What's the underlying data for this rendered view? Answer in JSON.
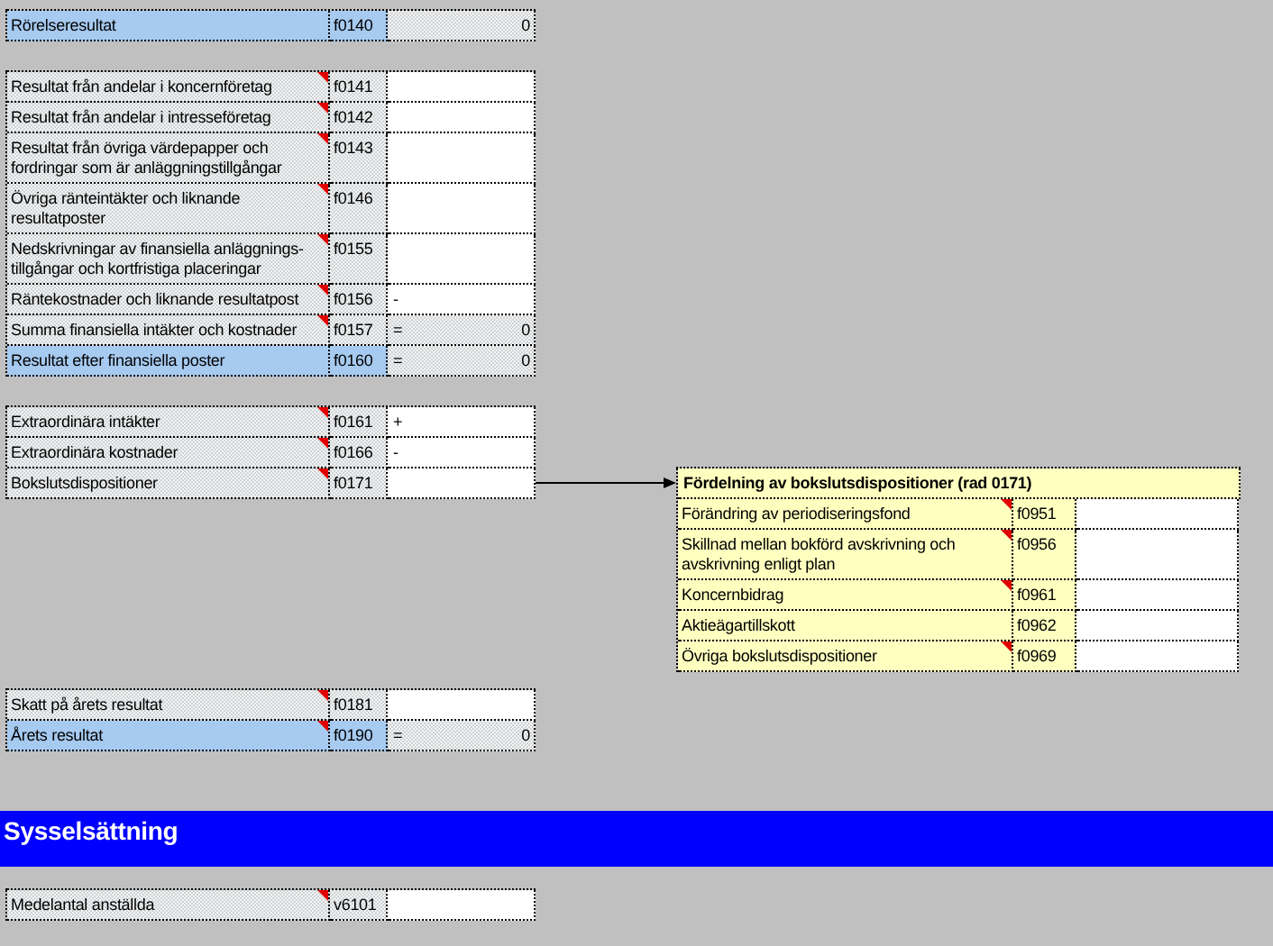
{
  "sections": [
    {
      "rows": [
        {
          "label": "Rörelseresultat",
          "code": "f0140",
          "note": false,
          "total": true,
          "kind": "computed",
          "sign": "",
          "value": "0"
        }
      ]
    },
    {
      "rows": [
        {
          "label": "Resultat från andelar i koncernföretag",
          "code": "f0141",
          "note": true,
          "total": false,
          "kind": "input",
          "sign": "",
          "value": ""
        },
        {
          "label": "Resultat från andelar i intresseföretag",
          "code": "f0142",
          "note": true,
          "total": false,
          "kind": "input",
          "sign": "",
          "value": ""
        },
        {
          "label": "Resultat från övriga värdepapper och fordringar som är anläggningstillgångar",
          "code": "f0143",
          "note": true,
          "total": false,
          "kind": "input",
          "sign": "",
          "value": ""
        },
        {
          "label": "Övriga ränteintäkter och liknande resultatposter",
          "code": "f0146",
          "note": true,
          "total": false,
          "kind": "input",
          "sign": "",
          "value": ""
        },
        {
          "label": "Nedskrivningar av finansiella anläggnings-tillgångar och kortfristiga placeringar",
          "code": "f0155",
          "note": true,
          "total": false,
          "kind": "input",
          "sign": "",
          "value": ""
        },
        {
          "label": "Räntekostnader och liknande resultatpost",
          "code": "f0156",
          "note": true,
          "total": false,
          "kind": "input",
          "sign": "-",
          "value": ""
        },
        {
          "label": "Summa finansiella intäkter och kostnader",
          "code": "f0157",
          "note": true,
          "total": false,
          "kind": "computed",
          "sign": "=",
          "value": "0"
        },
        {
          "label": "Resultat efter finansiella poster",
          "code": "f0160",
          "note": false,
          "total": true,
          "kind": "computed",
          "sign": "=",
          "value": "0"
        }
      ]
    },
    {
      "rows": [
        {
          "label": "Extraordinära intäkter",
          "code": "f0161",
          "note": true,
          "total": false,
          "kind": "input",
          "sign": "+",
          "value": ""
        },
        {
          "label": "Extraordinära kostnader",
          "code": "f0166",
          "note": true,
          "total": false,
          "kind": "input",
          "sign": "-",
          "value": ""
        },
        {
          "label": "Bokslutsdispositioner",
          "code": "f0171",
          "note": true,
          "total": false,
          "kind": "input",
          "sign": "",
          "value": ""
        }
      ],
      "breakdown": {
        "title": "Fördelning av bokslutsdispositioner (rad 0171)",
        "rows": [
          {
            "label": "Förändring av periodiseringsfond",
            "code": "f0951",
            "note": true
          },
          {
            "label": "Skillnad mellan bokförd avskrivning och avskrivning enligt plan",
            "code": "f0956",
            "note": true
          },
          {
            "label": "Koncernbidrag",
            "code": "f0961",
            "note": true
          },
          {
            "label": "Aktieägartillskott",
            "code": "f0962",
            "note": false
          },
          {
            "label": "Övriga bokslutsdispositioner",
            "code": "f0969",
            "note": true
          }
        ]
      }
    },
    {
      "rows": [
        {
          "label": "Skatt på årets resultat",
          "code": "f0181",
          "note": true,
          "total": false,
          "kind": "input",
          "sign": "",
          "value": ""
        },
        {
          "label": "Årets resultat",
          "code": "f0190",
          "note": true,
          "total": true,
          "kind": "computed",
          "sign": "=",
          "value": "0"
        }
      ]
    }
  ],
  "heading": "Sysselsättning",
  "after_heading": {
    "rows": [
      {
        "label": "Medelantal anställda",
        "code": "v6101",
        "note": true,
        "total": false,
        "kind": "input",
        "sign": "",
        "value": ""
      }
    ]
  }
}
